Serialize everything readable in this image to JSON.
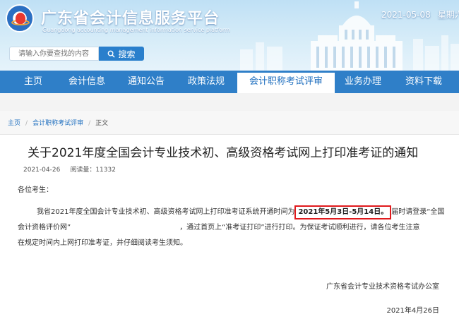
{
  "header": {
    "site_title": "广东省会计信息服务平台",
    "site_subtitle": "Guangdong accounting management information service platform",
    "date": "2021-05-08",
    "weekday": "星期六"
  },
  "search": {
    "placeholder": "请输入你要查找的内容",
    "button_label": "搜索",
    "icon": "search-icon"
  },
  "nav": {
    "items": [
      {
        "label": "主页"
      },
      {
        "label": "会计信息"
      },
      {
        "label": "通知公告"
      },
      {
        "label": "政策法规"
      },
      {
        "label": "会计职称考试评审"
      },
      {
        "label": "业务办理"
      },
      {
        "label": "资料下载"
      }
    ],
    "active_index": 4
  },
  "breadcrumb": {
    "home": "主页",
    "section": "会计职称考试评审",
    "current": "正文"
  },
  "article": {
    "title": "关于2021年度全国会计专业技术初、高级资格考试网上打印准考证的通知",
    "date": "2021-04-26",
    "views": "阅读量：11332",
    "greeting": "各位考生：",
    "para_line1_before": "我省2021年度全国会计专业技术初、高级资格考试网上打印准考证系统开通时间为",
    "para_highlight": "2021年5月3日-5月14日。",
    "para_line1_after": "届时请登录“全国",
    "para_line2_before": "会计资格评价网”",
    "para_line2_after": "，通过首页上“准考证打印”进行打印。为保证考试顺利进行，请各位考生注意",
    "para_line3": "在规定时间内上网打印准考证，并仔细阅读考生须知。",
    "office": "广东省会计专业技术资格考试办公室",
    "sign_date": "2021年4月26日"
  },
  "colors": {
    "nav_bg": "#2f7fc8",
    "accent_blue": "#1f6fbf",
    "highlight_border": "#e0191c"
  }
}
